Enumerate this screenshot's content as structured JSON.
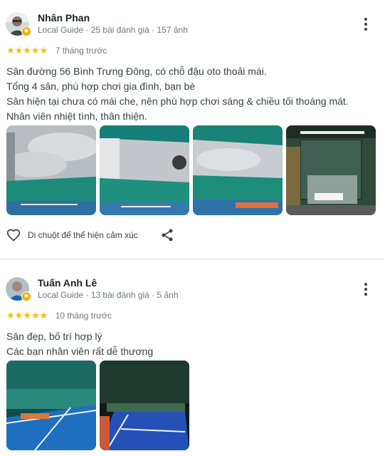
{
  "reviews": [
    {
      "name": "Nhân Phan",
      "guide": "Local Guide",
      "reviews_count": "25 bài đánh giá",
      "photos_count": "157 ảnh",
      "sep": "·",
      "stars": "★★★★★",
      "rating": 5,
      "time": "7 tháng trước",
      "text": [
        "Sân đường 56 Bình Trưng Đông, có chỗ đậu oto thoải mái.",
        "Tổng 4 sân, phù hợp chơi gia đình, bạn bè",
        "Sân hiện tại chưa có mái che, nên phù hợp chơi sáng & chiều tối thoáng mát.",
        "Nhân viên nhiệt tình, thân thiện."
      ],
      "react_label": "Di chuột để thể hiện cảm xúc"
    },
    {
      "name": "Tuấn Anh Lê",
      "guide": "Local Guide",
      "reviews_count": "13 bài đánh giá",
      "photos_count": "5 ảnh",
      "sep": "·",
      "stars": "★★★★★",
      "rating": 5,
      "time": "10 tháng trước",
      "text": [
        "Sân đẹp, bố trí hợp lý",
        "Các bạn nhân viên rất dễ thương"
      ]
    }
  ],
  "colors": {
    "star": "#fbbc04",
    "badge": "#f9ab00",
    "meta": "#70757a"
  },
  "icons": {
    "more": "more-vert-icon",
    "heart": "heart-outline-icon",
    "share": "share-icon",
    "badge": "local-guide-badge-icon"
  }
}
